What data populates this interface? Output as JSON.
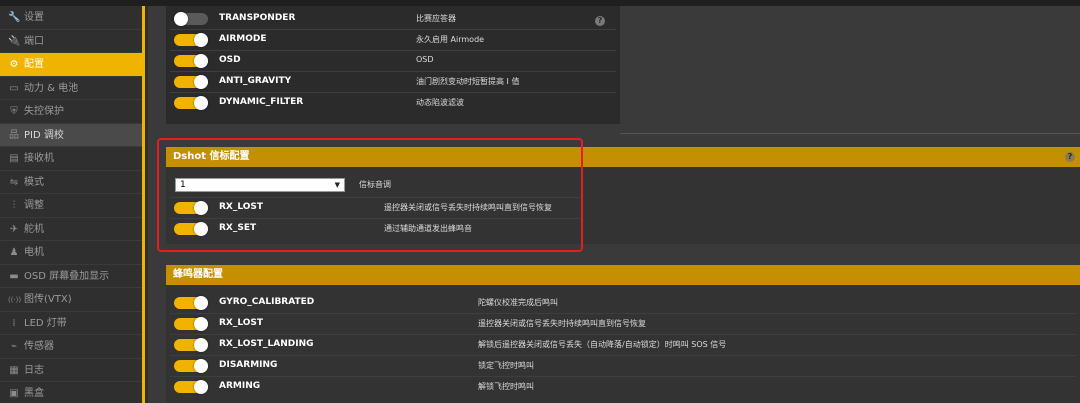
{
  "sidebar": {
    "items": [
      {
        "icon": "wrench-icon",
        "glyph": "🔧",
        "label": "设置"
      },
      {
        "icon": "plug-icon",
        "glyph": "🔌",
        "label": "端口"
      },
      {
        "icon": "gear-icon",
        "glyph": "⚙",
        "label": "配置"
      },
      {
        "icon": "battery-icon",
        "glyph": "▭",
        "label": "动力 & 电池"
      },
      {
        "icon": "shield-icon",
        "glyph": "⛨",
        "label": "失控保护"
      },
      {
        "icon": "sitemap-icon",
        "glyph": "品",
        "label": "PID 调校"
      },
      {
        "icon": "receiver-icon",
        "glyph": "▤",
        "label": "接收机"
      },
      {
        "icon": "toggle-icon",
        "glyph": "⇋",
        "label": "模式"
      },
      {
        "icon": "sliders-icon",
        "glyph": "⫶",
        "label": "调整"
      },
      {
        "icon": "plane-icon",
        "glyph": "✈",
        "label": "舵机"
      },
      {
        "icon": "motor-icon",
        "glyph": "♟",
        "label": "电机"
      },
      {
        "icon": "osd-icon",
        "glyph": "▬",
        "label": "OSD 屏幕叠加显示"
      },
      {
        "icon": "vtx-icon",
        "glyph": "((·))",
        "label": "图传(VTX)"
      },
      {
        "icon": "led-icon",
        "glyph": "⁞",
        "label": "LED 灯带"
      },
      {
        "icon": "sensor-icon",
        "glyph": "⌁",
        "label": "传感器"
      },
      {
        "icon": "log-icon",
        "glyph": "▦",
        "label": "日志"
      },
      {
        "icon": "blackbox-icon",
        "glyph": "▣",
        "label": "黑盒"
      }
    ]
  },
  "features": [
    {
      "name": "TRANSPONDER",
      "desc": "比赛应答器",
      "on": false
    },
    {
      "name": "AIRMODE",
      "desc": "永久启用 Airmode",
      "on": true
    },
    {
      "name": "OSD",
      "desc": "OSD",
      "on": true
    },
    {
      "name": "ANTI_GRAVITY",
      "desc": "油门剧烈变动时短暂提高 I 值",
      "on": true
    },
    {
      "name": "DYNAMIC_FILTER",
      "desc": "动态陷波滤波",
      "on": true
    }
  ],
  "dshot": {
    "title": "Dshot 信标配置",
    "select_value": "1",
    "select_label": "信标音调",
    "items": [
      {
        "name": "RX_LOST",
        "desc": "遥控器关闭或信号丢失时持续鸣叫直到信号恢复",
        "on": true
      },
      {
        "name": "RX_SET",
        "desc": "通过辅助通道发出蜂鸣音",
        "on": true
      }
    ]
  },
  "beeper": {
    "title": "蜂鸣器配置",
    "items": [
      {
        "name": "GYRO_CALIBRATED",
        "desc": "陀螺仪校准完成后鸣叫",
        "on": true
      },
      {
        "name": "RX_LOST",
        "desc": "遥控器关闭或信号丢失时持续鸣叫直到信号恢复",
        "on": true
      },
      {
        "name": "RX_LOST_LANDING",
        "desc": "解锁后遥控器关闭或信号丢失（自动降落/自动锁定）时鸣叫 SOS 信号",
        "on": true
      },
      {
        "name": "DISARMING",
        "desc": "锁定飞控时鸣叫",
        "on": true
      },
      {
        "name": "ARMING",
        "desc": "解锁飞控时鸣叫",
        "on": true
      }
    ]
  },
  "colors": {
    "accent": "#f0b400",
    "section_header": "#c48f00",
    "highlight_box": "#e02020"
  }
}
